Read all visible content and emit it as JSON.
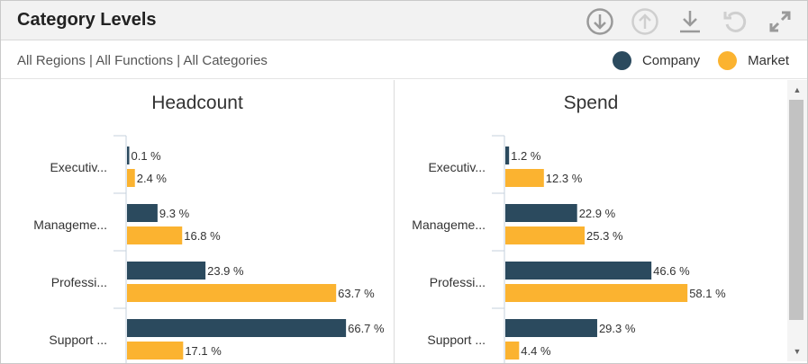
{
  "header": {
    "title": "Category Levels",
    "tools": [
      {
        "name": "drill-down-icon"
      },
      {
        "name": "drill-up-icon"
      },
      {
        "name": "download-icon"
      },
      {
        "name": "reset-icon"
      },
      {
        "name": "expand-icon"
      }
    ]
  },
  "subbar": {
    "filters": "All Regions | All Functions | All Categories"
  },
  "legend": {
    "company": {
      "label": "Company",
      "color": "#2b4a5e"
    },
    "market": {
      "label": "Market",
      "color": "#fbb330"
    }
  },
  "chart_data": [
    {
      "type": "bar",
      "title": "Headcount",
      "categories": [
        "Executiv...",
        "Manageme...",
        "Professi...",
        "Support ..."
      ],
      "series": [
        {
          "name": "Company",
          "color": "#2b4a5e",
          "values": [
            0.1,
            9.3,
            23.9,
            66.7
          ],
          "labels": [
            "0.1 %",
            "9.3 %",
            "23.9 %",
            "66.7 %"
          ]
        },
        {
          "name": "Market",
          "color": "#fbb330",
          "values": [
            2.4,
            16.8,
            63.7,
            17.1
          ],
          "labels": [
            "2.4 %",
            "16.8 %",
            "63.7 %",
            "17.1 %"
          ]
        }
      ],
      "xlim": [
        0,
        70
      ],
      "orientation": "horizontal"
    },
    {
      "type": "bar",
      "title": "Spend",
      "categories": [
        "Executiv...",
        "Manageme...",
        "Professi...",
        "Support ..."
      ],
      "series": [
        {
          "name": "Company",
          "color": "#2b4a5e",
          "values": [
            1.2,
            22.9,
            46.6,
            29.3
          ],
          "labels": [
            "1.2 %",
            "22.9 %",
            "46.6 %",
            "29.3 %"
          ]
        },
        {
          "name": "Market",
          "color": "#fbb330",
          "values": [
            12.3,
            25.3,
            58.1,
            4.4
          ],
          "labels": [
            "12.3 %",
            "25.3 %",
            "58.1 %",
            "4.4 %"
          ]
        }
      ],
      "xlim": [
        0,
        70
      ],
      "orientation": "horizontal"
    }
  ]
}
